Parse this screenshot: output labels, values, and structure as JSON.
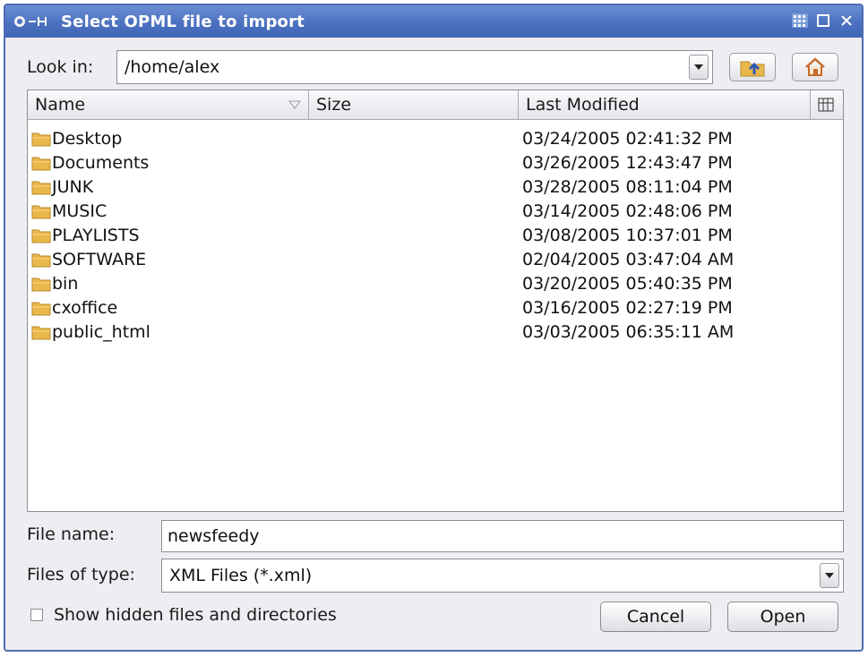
{
  "window": {
    "title": "Select OPML file to import"
  },
  "lookin": {
    "label": "Look in:",
    "value": "/home/alex"
  },
  "columns": [
    "Name",
    "Size",
    "Last Modified"
  ],
  "files": [
    {
      "name": "Desktop",
      "modified": "03/24/2005 02:41:32 PM"
    },
    {
      "name": "Documents",
      "modified": "03/26/2005 12:43:47 PM"
    },
    {
      "name": "JUNK",
      "modified": "03/28/2005 08:11:04 PM"
    },
    {
      "name": "MUSIC",
      "modified": "03/14/2005 02:48:06 PM"
    },
    {
      "name": "PLAYLISTS",
      "modified": "03/08/2005 10:37:01 PM"
    },
    {
      "name": "SOFTWARE",
      "modified": "02/04/2005 03:47:04 AM"
    },
    {
      "name": "bin",
      "modified": "03/20/2005 05:40:35 PM"
    },
    {
      "name": "cxoffice",
      "modified": "03/16/2005 02:27:19 PM"
    },
    {
      "name": "public_html",
      "modified": "03/03/2005 06:35:11 AM"
    }
  ],
  "filename": {
    "label": "File name:",
    "value": "newsfeedy"
  },
  "filetype": {
    "label": "Files of type:",
    "value": "XML Files (*.xml)"
  },
  "show_hidden": {
    "label": "Show hidden files and directories",
    "checked": false
  },
  "buttons": {
    "cancel": "Cancel",
    "open": "Open"
  },
  "icons": {
    "folder": "folder-icon",
    "up": "folder-up-icon",
    "home": "home-icon",
    "columns": "column-chooser-icon"
  },
  "colors": {
    "titlebar": "#4c71c0",
    "folder": "#e9b84a"
  }
}
